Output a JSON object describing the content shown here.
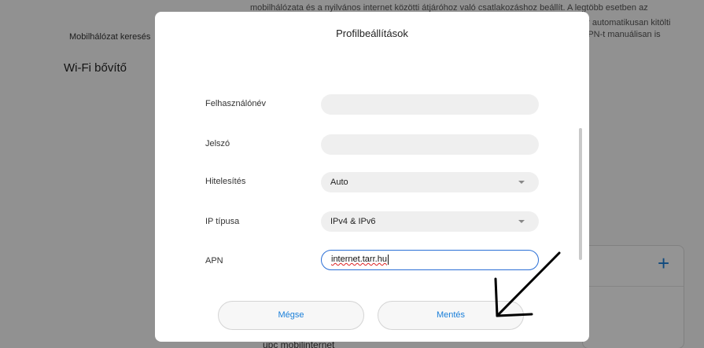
{
  "background": {
    "top_text": "mobilhálózata és a nyilvános internet közötti átjáróhoz való csatlakozáshoz beállít. A legtöbb esetben az",
    "right_text_line1": "or automatikusan kitölti",
    "right_text_line2": "APN-t manuálisan is",
    "left_item": "Mobilhálózat keresés",
    "left_heading": "Wi-Fi bővítő",
    "bottom_text": "upc mobilinternet"
  },
  "dialog": {
    "title": "Profilbeállítások",
    "fields": {
      "username": {
        "label": "Felhasználónév",
        "value": ""
      },
      "password": {
        "label": "Jelszó",
        "value": ""
      },
      "auth": {
        "label": "Hitelesítés",
        "value": "Auto"
      },
      "ip_type": {
        "label": "IP típusa",
        "value": "IPv4 & IPv6"
      },
      "apn": {
        "label": "APN",
        "value": "internet.tarr.hu"
      }
    },
    "cancel_label": "Mégse",
    "save_label": "Mentés"
  },
  "colors": {
    "accent": "#1a7fd9",
    "focus_border": "#2b6fd6",
    "annotation_arrow": "#000000"
  },
  "icons": {
    "add": "plus-icon",
    "dropdown": "chevron-down-icon",
    "annotation": "arrow-icon"
  }
}
